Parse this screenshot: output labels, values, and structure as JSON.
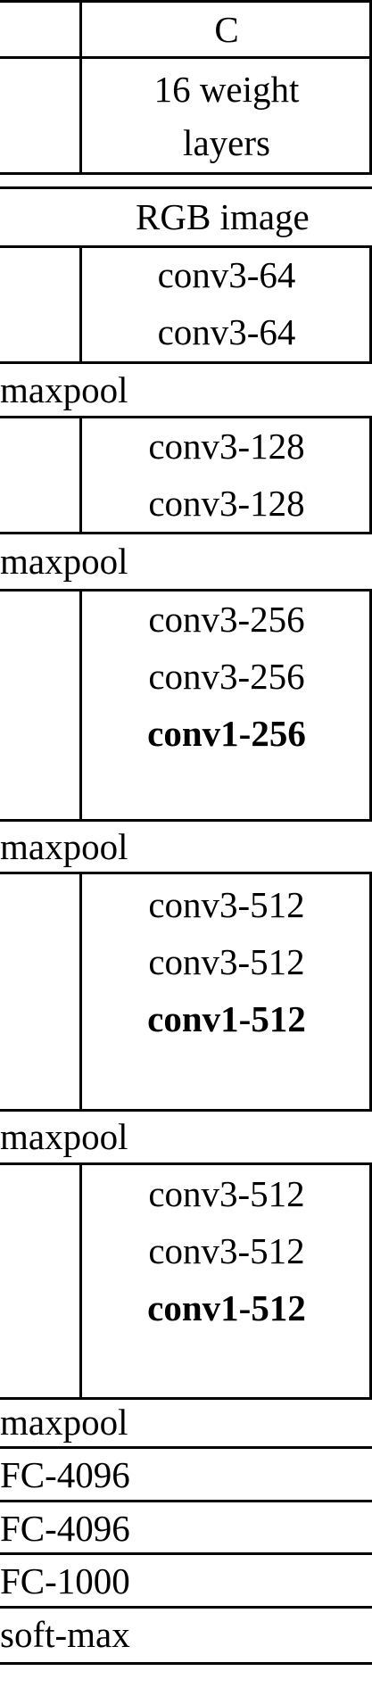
{
  "table": {
    "column_header": "C",
    "depth_label": [
      "16 weight",
      "layers"
    ],
    "input_row": "RGB image",
    "blocks": [
      {
        "layers": [
          {
            "text": "conv3-64",
            "bold": false
          },
          {
            "text": "conv3-64",
            "bold": false
          }
        ],
        "pool": "maxpool"
      },
      {
        "layers": [
          {
            "text": "conv3-128",
            "bold": false
          },
          {
            "text": "conv3-128",
            "bold": false
          }
        ],
        "pool": "maxpool"
      },
      {
        "layers": [
          {
            "text": "conv3-256",
            "bold": false
          },
          {
            "text": "conv3-256",
            "bold": false
          },
          {
            "text": "conv1-256",
            "bold": true
          }
        ],
        "pool": "maxpool"
      },
      {
        "layers": [
          {
            "text": "conv3-512",
            "bold": false
          },
          {
            "text": "conv3-512",
            "bold": false
          },
          {
            "text": "conv1-512",
            "bold": true
          }
        ],
        "pool": "maxpool"
      },
      {
        "layers": [
          {
            "text": "conv3-512",
            "bold": false
          },
          {
            "text": "conv3-512",
            "bold": false
          },
          {
            "text": "conv1-512",
            "bold": true
          }
        ],
        "pool": "maxpool"
      }
    ],
    "fc_rows": [
      "FC-4096",
      "FC-4096",
      "FC-1000",
      "soft-max"
    ]
  }
}
